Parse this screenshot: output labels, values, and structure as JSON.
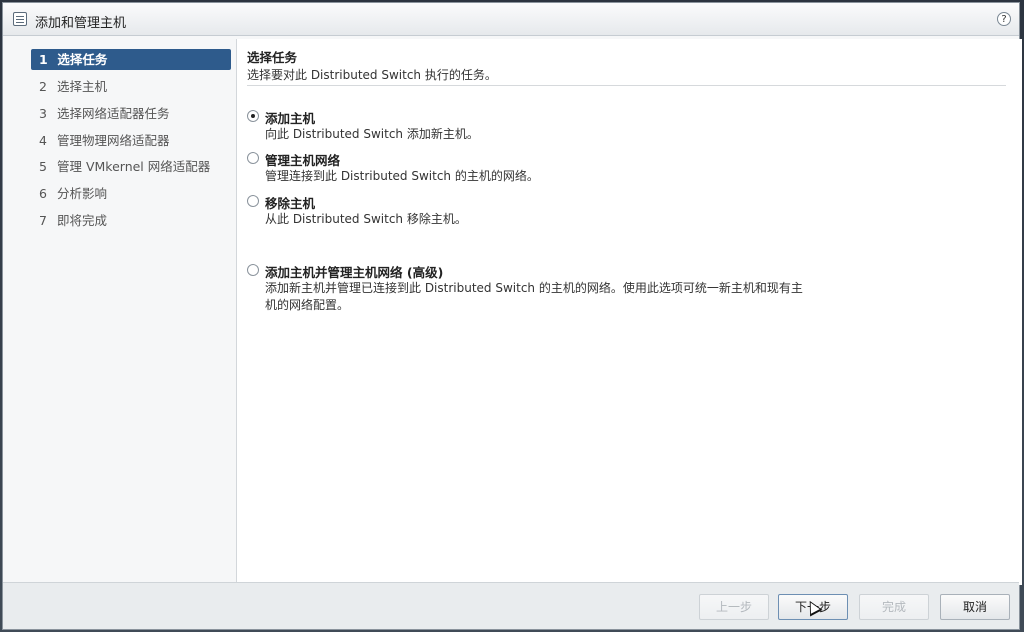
{
  "dialog": {
    "title": "添加和管理主机",
    "help_icon": "?"
  },
  "nav": {
    "items": [
      {
        "num": "1",
        "label": "选择任务",
        "active": true
      },
      {
        "num": "2",
        "label": "选择主机"
      },
      {
        "num": "3",
        "label": "选择网络适配器任务"
      },
      {
        "num": "4",
        "label": "管理物理网络适配器"
      },
      {
        "num": "5",
        "label": "管理 VMkernel 网络适配器"
      },
      {
        "num": "6",
        "label": "分析影响"
      },
      {
        "num": "7",
        "label": "即将完成"
      }
    ]
  },
  "content": {
    "title": "选择任务",
    "subtitle": "选择要对此 Distributed Switch 执行的任务。",
    "options": [
      {
        "label": "添加主机",
        "desc": "向此 Distributed Switch 添加新主机。",
        "checked": true
      },
      {
        "label": "管理主机网络",
        "desc": "管理连接到此 Distributed Switch 的主机的网络。",
        "checked": false
      },
      {
        "label": "移除主机",
        "desc": "从此 Distributed Switch 移除主机。",
        "checked": false
      },
      {
        "label": "添加主机并管理主机网络 (高级)",
        "desc": "添加新主机并管理已连接到此 Distributed Switch 的主机的网络。使用此选项可统一新主机和现有主机的网络配置。",
        "checked": false
      }
    ]
  },
  "footer": {
    "back_label": "上一步",
    "next_label": "下一步",
    "finish_label": "完成",
    "cancel_label": "取消"
  }
}
